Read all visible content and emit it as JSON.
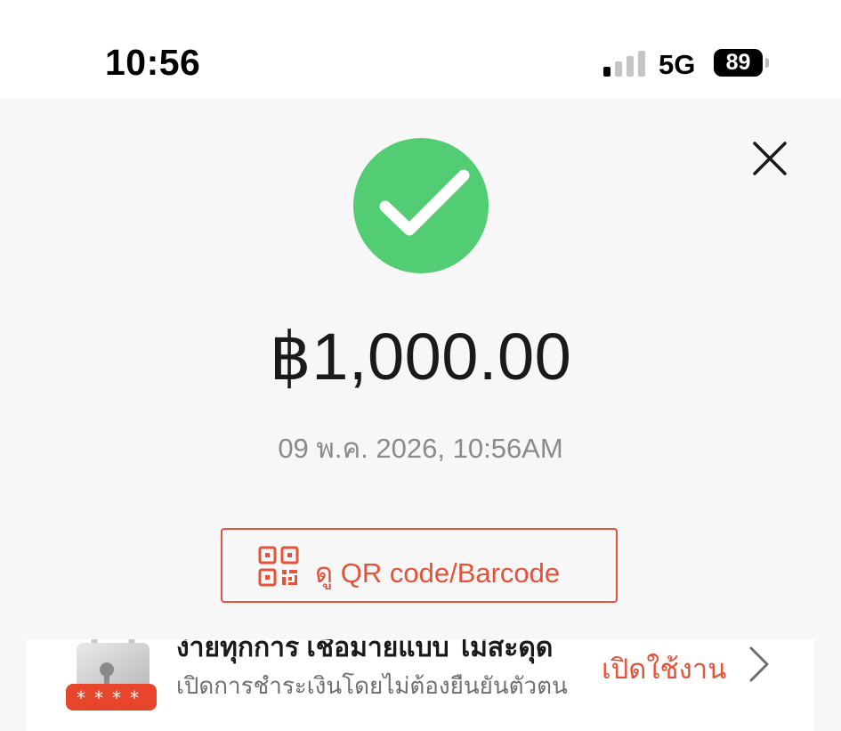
{
  "status_bar": {
    "time": "10:56",
    "network": "5G",
    "battery": "89",
    "signal_level": 1,
    "signal_max": 4
  },
  "receipt": {
    "amount": "฿1,000.00",
    "datetime": "09 พ.ค. 2026, 10:56AM",
    "status_icon": "check-circle-icon",
    "status_color": "#52cd74"
  },
  "actions": {
    "qr_label": "ดู QR code/Barcode",
    "qr_icon": "qr-code-icon",
    "close_icon": "close-icon"
  },
  "promo": {
    "title": "ง่ายทุกการ เชื่อมายแบบ ไม่สะดุด",
    "subtitle": "เปิดการชำระเงินโดยไม่ต้องยืนยันตัวตน",
    "action": "เปิดใช้งาน",
    "icon": "lock-icon",
    "chevron_icon": "chevron-right-icon"
  },
  "colors": {
    "accent": "#e2533a",
    "success": "#52cd74",
    "background": "#f7f7f7"
  }
}
